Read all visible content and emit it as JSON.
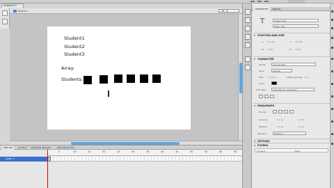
{
  "document_tab": "Untitled-1*",
  "edit_bar": {
    "scene_label": "Scene 1"
  },
  "stage_text": {
    "students": [
      "Student1",
      "Student2",
      "Student3"
    ],
    "array_label": "Array:",
    "students_label": "Students:"
  },
  "timeline": {
    "tabs": [
      "TIMELINE",
      "OUTPUT",
      "COMPILER ERRORS",
      "MOTION EDITOR"
    ],
    "frame_ticks": [
      "5",
      "10",
      "15",
      "20",
      "25",
      "30",
      "35",
      "40",
      "45",
      "50",
      "55",
      "60",
      "65"
    ],
    "layer_name": "Layer 1"
  },
  "properties": {
    "tabs": [
      "PROPERTIES",
      "LIBRARY"
    ],
    "text_type": "Classic Text",
    "text_subtype": "Static Text",
    "sections": {
      "position_size": "POSITION AND SIZE",
      "character": "CHARACTER",
      "paragraph": "PARAGRAPH",
      "options": "OPTIONS",
      "filters": "FILTERS"
    },
    "position": {
      "x_label": "X:",
      "x": "131.00",
      "y_label": "Y:",
      "y": "155.00",
      "w_label": "W:",
      "w": "12.00",
      "h_label": "H:",
      "h": "20.00"
    },
    "character": {
      "family_label": "Family:",
      "family": "Courier New",
      "style_label": "Style:",
      "style": "Regular",
      "size_label": "Size:",
      "size": "12.0 pt",
      "spacing_label": "Letter spacing:",
      "spacing": "0.0",
      "color_label": "Color:",
      "antialias_label": "Anti-alias:",
      "antialias": "Anti-alias for animation"
    },
    "paragraph": {
      "format_label": "Format:",
      "spacing_label": "Spacing:",
      "spacing_a": "0.0 px",
      "spacing_b": "2.0 pt",
      "margins_label": "Margins:",
      "margin_a": "0.0 px",
      "margin_b": "0.0 px",
      "behavior_label": "Behavior:",
      "behavior": "Multiline"
    },
    "filters_table": {
      "col1": "Property",
      "col2": "Value"
    }
  }
}
